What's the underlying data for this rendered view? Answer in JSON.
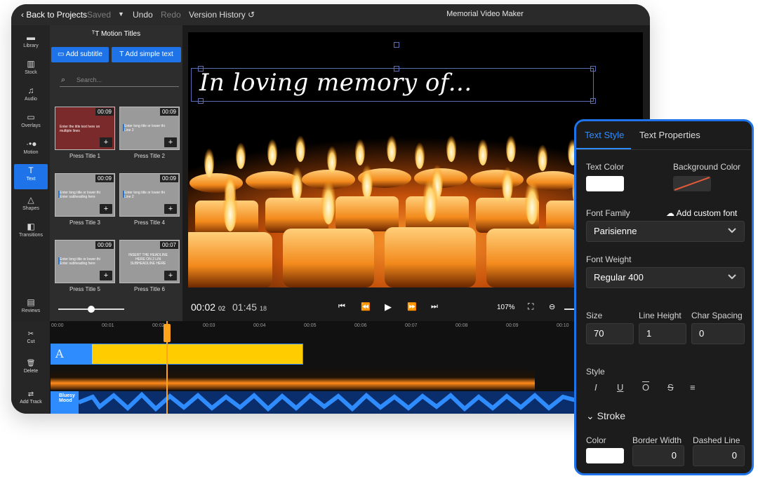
{
  "topbar": {
    "back": "Back to Projects",
    "saved": "Saved",
    "undo": "Undo",
    "redo": "Redo",
    "version_history": "Version History",
    "app_title": "Memorial Video Maker"
  },
  "sidebar": {
    "items": [
      {
        "label": "Library",
        "icon": "folder-icon"
      },
      {
        "label": "Stock",
        "icon": "books-icon"
      },
      {
        "label": "Audio",
        "icon": "music-note-icon"
      },
      {
        "label": "Overlays",
        "icon": "overlay-icon"
      },
      {
        "label": "Motion",
        "icon": "motion-icon"
      },
      {
        "label": "Text",
        "icon": "text-icon"
      },
      {
        "label": "Shapes",
        "icon": "shapes-icon"
      },
      {
        "label": "Transitions",
        "icon": "transitions-icon"
      },
      {
        "label": "Reviews",
        "icon": "chat-icon"
      }
    ]
  },
  "panel": {
    "title": "Motion Titles",
    "add_subtitle": "Add subtitle",
    "add_simple_text": "Add simple text",
    "search_placeholder": "Search...",
    "titles": [
      {
        "label": "Press Title 1",
        "duration": "00:09",
        "preview": "Enter the title text here on multiple lines"
      },
      {
        "label": "Press Title 2",
        "duration": "00:09",
        "preview": "Enter long title or lower thi Line 2"
      },
      {
        "label": "Press Title 3",
        "duration": "00:09",
        "preview": "Enter long title or lower thi Enter subheading here"
      },
      {
        "label": "Press Title 4",
        "duration": "00:09",
        "preview": "Enter long title or lower thi Line 2"
      },
      {
        "label": "Press Title 5",
        "duration": "00:09",
        "preview": "Enter long title or lower thi Enter subheading here"
      },
      {
        "label": "Press Title 6",
        "duration": "00:07",
        "preview": "INSERT THE HEADLINE HERE ON 2 LIN SUBHEADLINE HERE"
      }
    ]
  },
  "preview": {
    "headline": "In loving memory of..."
  },
  "transport": {
    "current_time": "00:02",
    "current_frames": "02",
    "total_time": "01:45",
    "total_frames": "18",
    "zoom": "107%"
  },
  "timeline": {
    "tools": [
      {
        "label": "Cut",
        "icon": "scissors-icon"
      },
      {
        "label": "Delete",
        "icon": "trash-icon"
      },
      {
        "label": "Add Track",
        "icon": "add-track-icon"
      }
    ],
    "ruler": [
      "00:00",
      "00:01",
      "00:02",
      "00:03",
      "00:04",
      "00:05",
      "00:06",
      "00:07",
      "00:08",
      "00:09",
      "00:10"
    ],
    "audio_label": "Bluesy Mood"
  },
  "props": {
    "tab_text_style": "Text Style",
    "tab_text_properties": "Text Properties",
    "text_color_label": "Text Color",
    "bg_color_label": "Background Color",
    "text_color": "#ffffff",
    "font_family_label": "Font Family",
    "add_custom_font": "Add custom font",
    "font_family": "Parisienne",
    "font_weight_label": "Font Weight",
    "font_weight": "Regular 400",
    "size_label": "Size",
    "size": "70",
    "line_height_label": "Line Height",
    "line_height": "1",
    "char_spacing_label": "Char Spacing",
    "char_spacing": "0",
    "style_label": "Style",
    "stroke_label": "Stroke",
    "stroke_color_label": "Color",
    "border_width_label": "Border Width",
    "border_width": "0",
    "dashed_line_label": "Dashed Line",
    "dashed_line": "0"
  },
  "colors": {
    "accent": "#1e73e8",
    "title_clip": "#ffcc00",
    "playhead": "#ffa31a"
  }
}
